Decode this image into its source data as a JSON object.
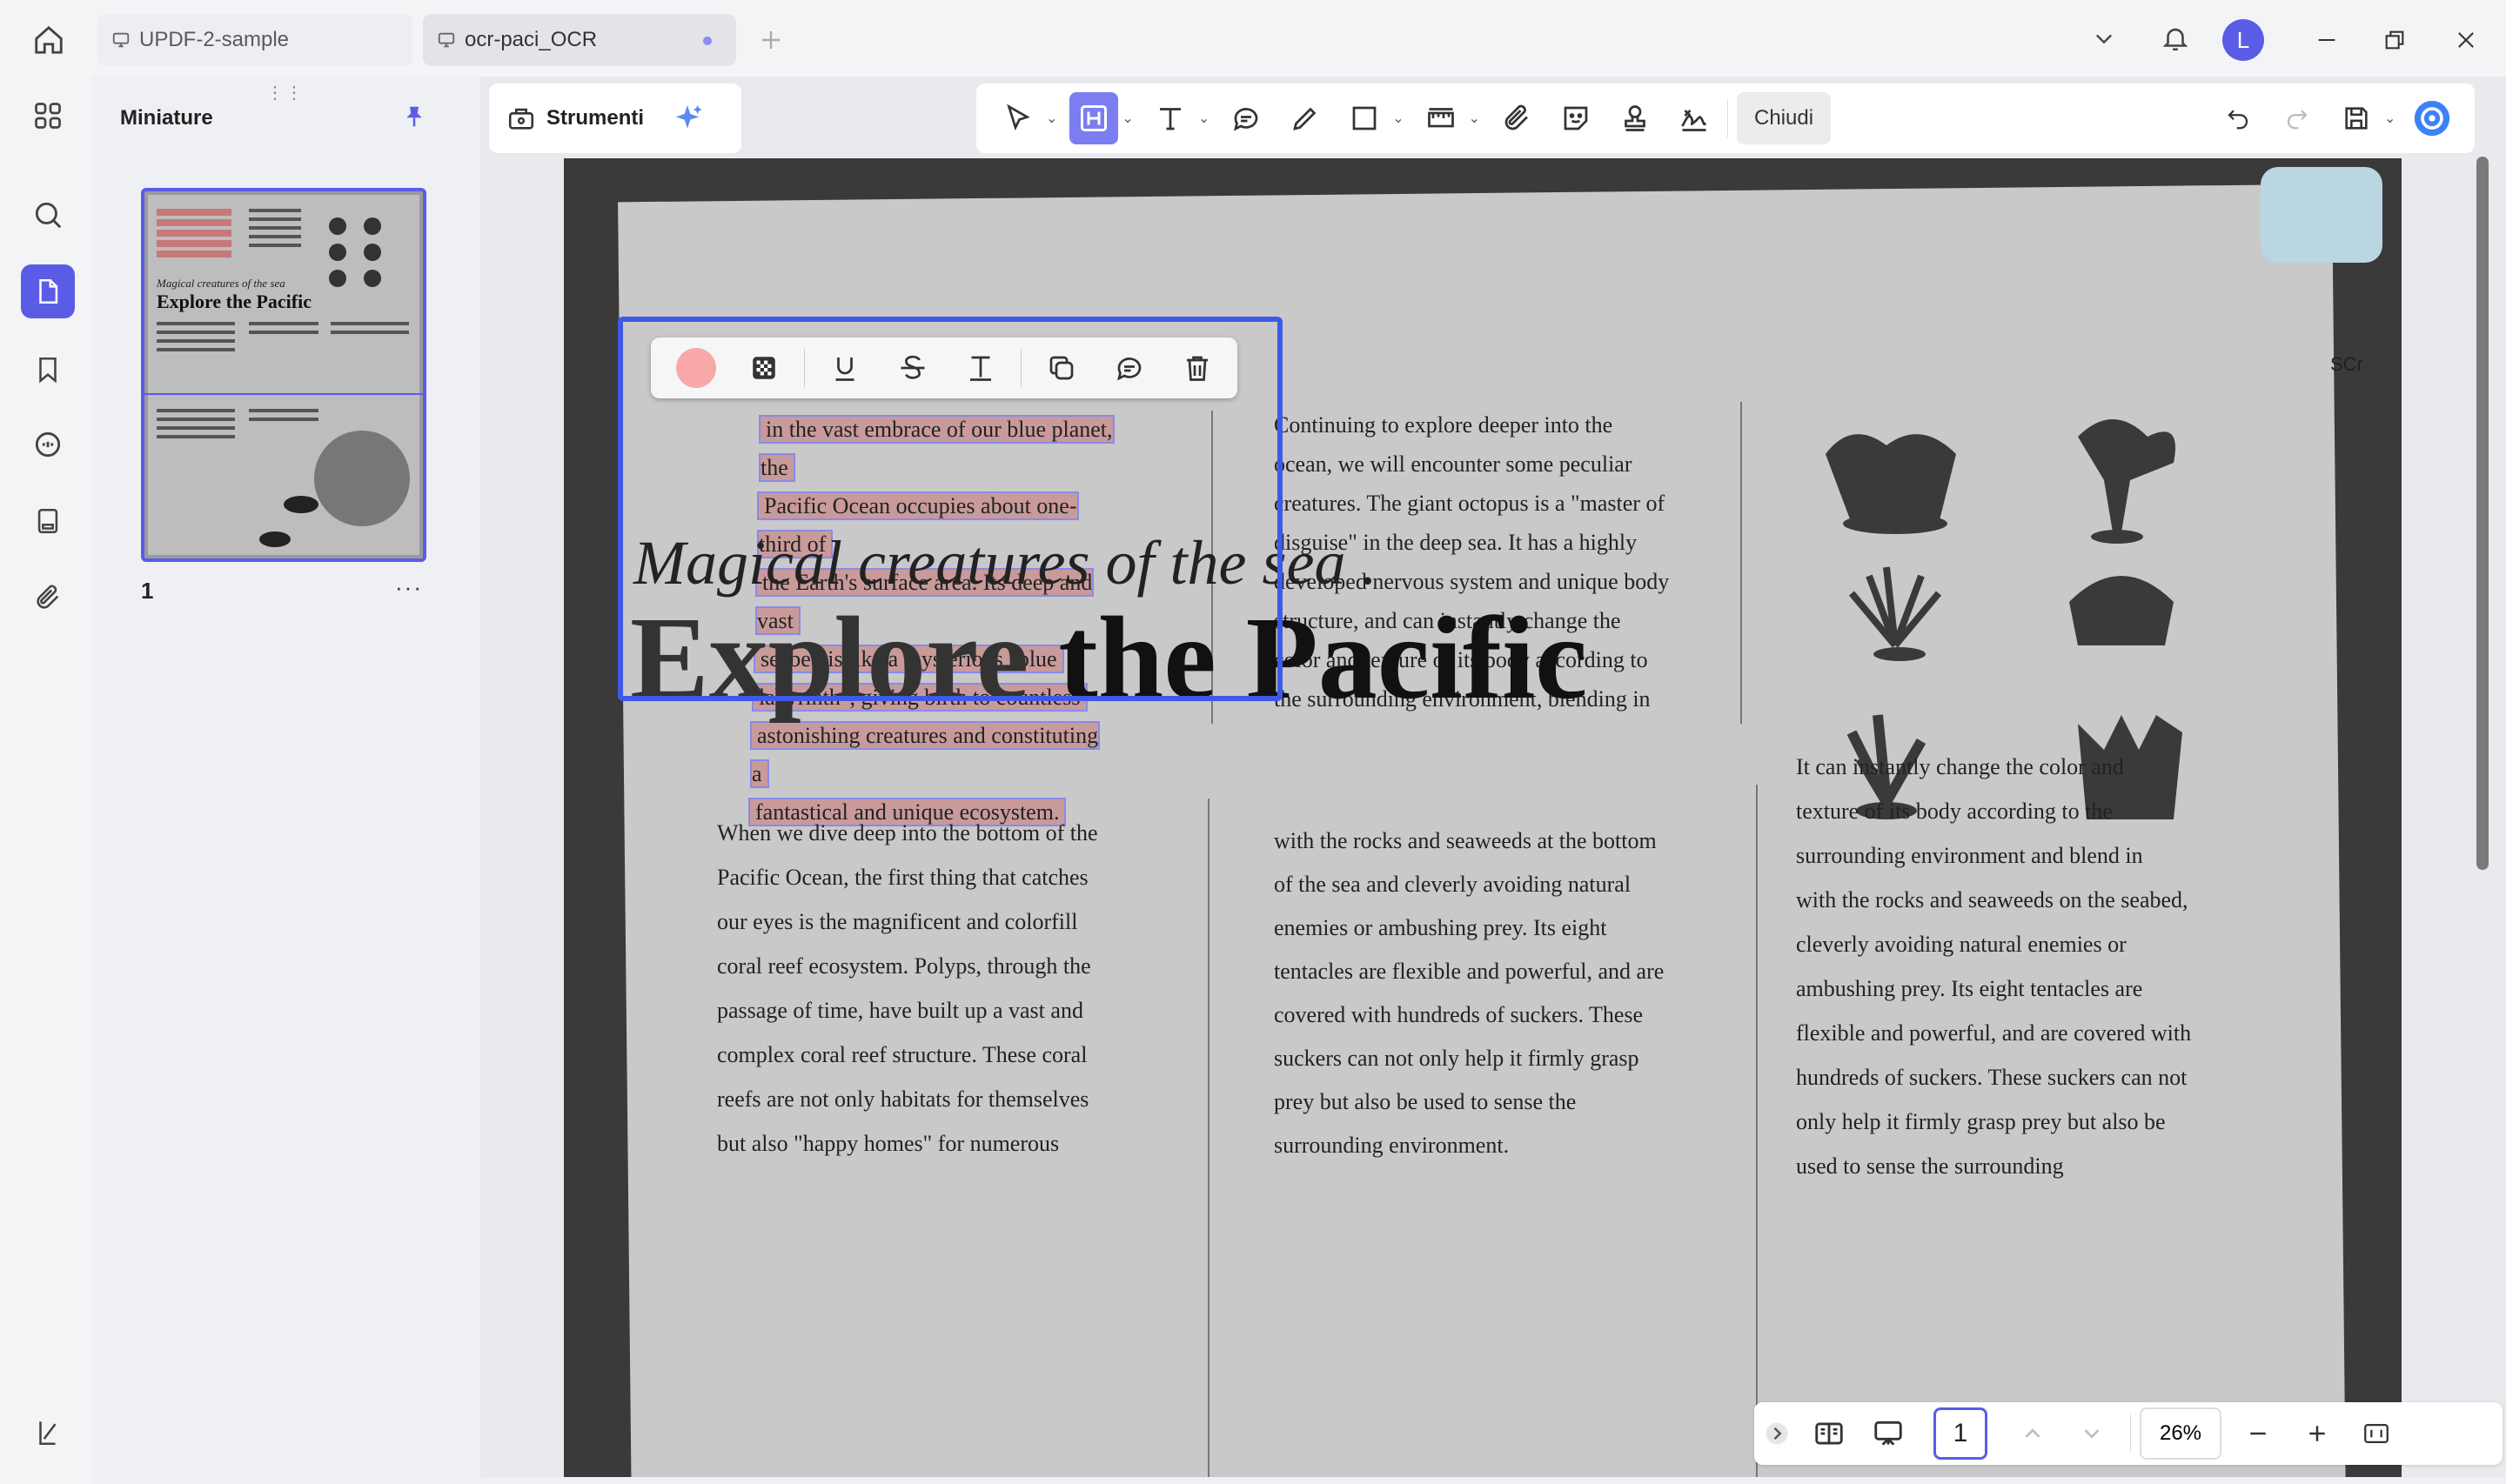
{
  "tabs": [
    {
      "label": "UPDF-2-sample"
    },
    {
      "label": "ocr-paci_OCR"
    }
  ],
  "user": {
    "initial": "L"
  },
  "sidebar": {
    "title": "Miniature",
    "page_number": "1",
    "more": "···"
  },
  "toolbar": {
    "tools_label": "Strumenti",
    "close_label": "Chiudi"
  },
  "document": {
    "selected_text_lines": [
      "in the vast embrace of our blue planet, the",
      "Pacific Ocean occupies about one-third of",
      "the Earth's surface area. Its deep and vast",
      "seabed is like a mysterious \"blue",
      "labyrinth\", giving birth to countless",
      "astonishing creatures and constituting a",
      "fantastical and unique ecosystem."
    ],
    "col2_top_lines": [
      "Continuing to explore deeper into the",
      "ocean, we will encounter some peculiar",
      "creatures. The giant octopus is a \"master of",
      "disguise\" in the deep sea. It has a highly",
      "developed nervous system and unique body",
      "structure, and can instantly change the",
      "color and texture of its body according to",
      "the surrounding environment, blending in"
    ],
    "subtitle": "Magical creatures of the sea .",
    "title_part1": "Explore",
    "title_part2": "the Pacific",
    "right_col_lines": [
      "It can instantly change the color and",
      "texture of its body according to the",
      "surrounding environment and blend in",
      "with the rocks and seaweeds on the seabed,",
      "cleverly avoiding natural enemies or",
      "ambushing prey. Its eight tentacles are",
      "flexible and powerful, and are covered with",
      "hundreds of suckers. These suckers can not",
      "only help it firmly grasp prey but also be",
      "used to sense the surrounding"
    ],
    "col_a_lines": [
      "When we dive deep into the bottom of the",
      "Pacific Ocean, the first thing that catches",
      "our eyes is the magnificent and colorfill",
      "coral reef ecosystem. Polyps, through the",
      "passage of time, have built up a vast and",
      "complex coral reef structure. These coral",
      "reefs are not only habitats for themselves",
      "but also \"happy homes\" for numerous"
    ],
    "col_b_lines": [
      "with the rocks and seaweeds at the bottom",
      "of the sea and cleverly avoiding natural",
      "enemies or ambushing prey. Its eight",
      "tentacles are flexible and powerful, and are",
      "covered with hundreds of suckers. These",
      "suckers can not only help it firmly grasp",
      "prey but also be used to sense the",
      "surrounding environment."
    ],
    "corner_label": "SCr"
  },
  "footer": {
    "page_input": "1",
    "zoom": "26%"
  },
  "colors": {
    "accent": "#5b5ce6",
    "highlight": "#c99a9a",
    "selection": "#3f5ae6"
  }
}
